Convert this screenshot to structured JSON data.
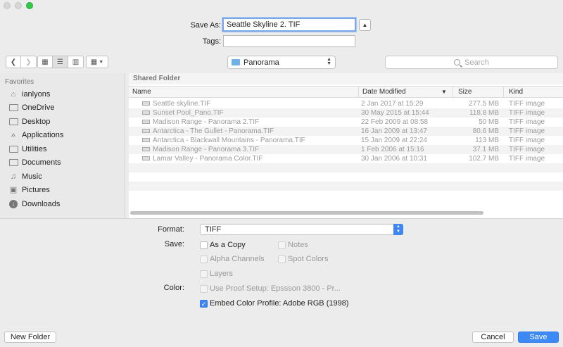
{
  "save_as": {
    "label": "Save As:",
    "value": "Seattle Skyline 2. TIF"
  },
  "tags": {
    "label": "Tags:",
    "value": ""
  },
  "location": {
    "folder": "Panorama"
  },
  "search": {
    "placeholder": "Search"
  },
  "sidebar": {
    "heading": "Favorites",
    "items": [
      {
        "label": "ianlyons",
        "icon": "home-icon"
      },
      {
        "label": "OneDrive",
        "icon": "folder-icon"
      },
      {
        "label": "Desktop",
        "icon": "desktop-icon"
      },
      {
        "label": "Applications",
        "icon": "applications-icon"
      },
      {
        "label": "Utilities",
        "icon": "folder-icon"
      },
      {
        "label": "Documents",
        "icon": "documents-icon"
      },
      {
        "label": "Music",
        "icon": "music-icon"
      },
      {
        "label": "Pictures",
        "icon": "pictures-icon"
      },
      {
        "label": "Downloads",
        "icon": "downloads-icon"
      }
    ]
  },
  "browser": {
    "section_title": "Shared Folder",
    "columns": {
      "name": "Name",
      "date": "Date Modified",
      "size": "Size",
      "kind": "Kind"
    },
    "rows": [
      {
        "name": "Seattle skyline.TIF",
        "date": "2 Jan 2017 at 15:29",
        "size": "277.5 MB",
        "kind": "TIFF image"
      },
      {
        "name": "Sunset Pool_Pano.TIF",
        "date": "30 May 2015 at 15:44",
        "size": "118.8 MB",
        "kind": "TIFF image"
      },
      {
        "name": "Madison Range - Panorama 2.TIF",
        "date": "22 Feb 2009 at 08:58",
        "size": "50 MB",
        "kind": "TIFF image"
      },
      {
        "name": "Antarctica - The Gullet - Panorama.TIF",
        "date": "16 Jan 2009 at 13:47",
        "size": "80.6 MB",
        "kind": "TIFF image"
      },
      {
        "name": "Antarctica - Blackwall Mountains - Panorama.TIF",
        "date": "15 Jan 2009 at 22:24",
        "size": "113 MB",
        "kind": "TIFF image"
      },
      {
        "name": "Madison Range - Panorama 3.TIF",
        "date": "1 Feb 2006 at 15:16",
        "size": "37.1 MB",
        "kind": "TIFF image"
      },
      {
        "name": "Lamar Valley - Panorama Color.TIF",
        "date": "30 Jan 2006 at 10:31",
        "size": "102.7 MB",
        "kind": "TIFF image"
      }
    ]
  },
  "options": {
    "format_label": "Format:",
    "format_value": "TIFF",
    "save_label": "Save:",
    "as_a_copy": "As a Copy",
    "notes": "Notes",
    "alpha_channels": "Alpha Channels",
    "spot_colors": "Spot Colors",
    "layers": "Layers",
    "color_label": "Color:",
    "use_proof_setup": "Use Proof Setup:  Epssson 3800 - Pr...",
    "embed_color_profile": "Embed Color Profile:  Adobe RGB (1998)"
  },
  "footer": {
    "new_folder": "New Folder",
    "cancel": "Cancel",
    "save": "Save"
  }
}
